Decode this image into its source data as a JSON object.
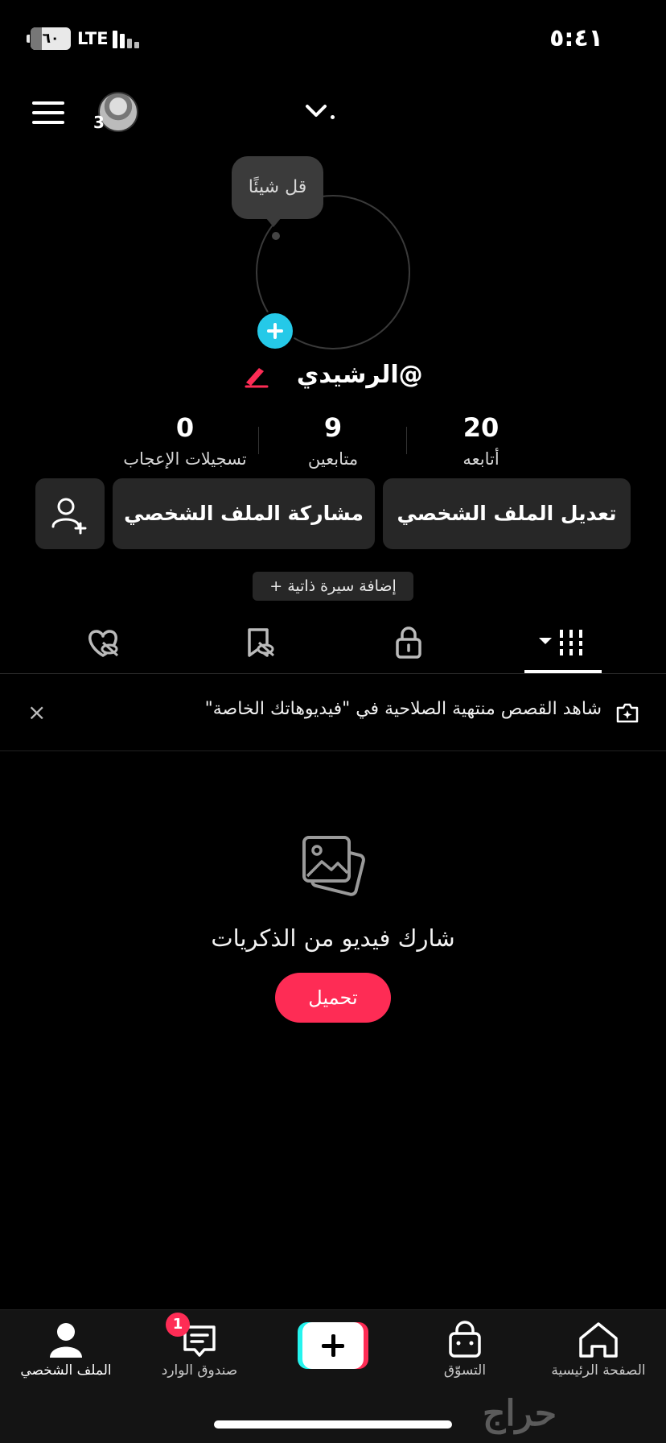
{
  "status_bar": {
    "time": "٥:٤١",
    "battery_level": "٦٠",
    "network": "LTE"
  },
  "top_bar": {
    "avatar_count": "3"
  },
  "profile": {
    "bubble_text": "قل شيئًا",
    "username": "@الرشيدي",
    "stats": [
      {
        "value": "20",
        "label": "أتابعه"
      },
      {
        "value": "9",
        "label": "متابعين"
      },
      {
        "value": "0",
        "label": "تسجيلات الإعجاب"
      }
    ],
    "buttons": {
      "edit": "تعديل الملف الشخصي",
      "share": "مشاركة الملف الشخصي"
    },
    "add_bio": "+ إضافة سيرة ذاتية"
  },
  "banner": {
    "text": "شاهد القصص منتهية الصلاحية في \"فيديوهاتك الخاصة\"",
    "close": "×"
  },
  "empty_state": {
    "title": "شارك فيديو من الذكريات",
    "upload": "تحميل"
  },
  "bottom_nav": {
    "items": [
      {
        "label": "الصفحة الرئيسية",
        "icon": "home-icon"
      },
      {
        "label": "التسوّق",
        "icon": "shop-icon"
      },
      {
        "label": "",
        "icon": "create-icon"
      },
      {
        "label": "صندوق الوارد",
        "icon": "inbox-icon"
      },
      {
        "label": "الملف الشخصي",
        "icon": "profile-icon"
      }
    ],
    "inbox_badge": "1"
  },
  "watermark": "حراج",
  "colors": {
    "accent": "#fe2c55",
    "cyan": "#25c9e8",
    "surface": "#272727"
  }
}
